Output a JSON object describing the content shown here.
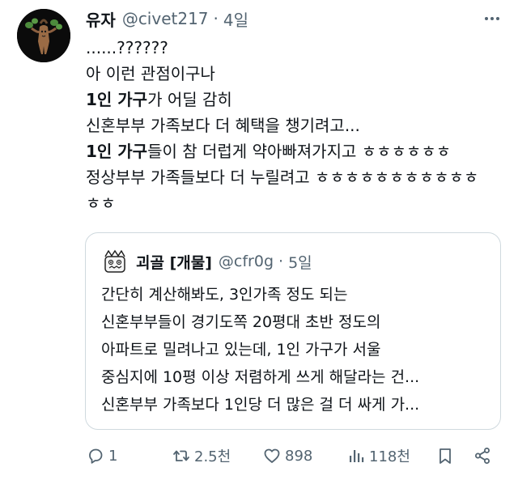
{
  "tweet": {
    "display_name": "유자",
    "handle": "@civet217",
    "separator": "·",
    "time": "4일",
    "avatar_icon": "mandrake-doll-avatar",
    "more_icon": "more-icon",
    "lines": [
      {
        "plain": "......??????"
      },
      {
        "plain": "아 이런 관점이구나"
      },
      {
        "bold": "1인 가구",
        "rest": "가 어딜 감히"
      },
      {
        "plain": "신혼부부 가족보다 더 혜택을 챙기려고..."
      },
      {
        "bold": "1인 가구",
        "rest": "들이 참 더럽게 약아빠져가지고 ㅎㅎㅎㅎㅎㅎ"
      },
      {
        "plain": "정상부부 가족들보다 더 누릴려고 ㅎㅎㅎㅎㅎㅎㅎㅎㅎㅎㅎ"
      },
      {
        "plain": "ㅎㅎ"
      }
    ]
  },
  "quote": {
    "display_name": "괴골 [개물]",
    "handle": "@cfr0g",
    "separator": "·",
    "time": "5일",
    "avatar_icon": "cartoon-face-avatar",
    "lines": [
      "간단히 계산해봐도, 3인가족 정도 되는",
      "신혼부부들이 경기도쪽 20평대 초반 정도의",
      "아파트로 밀려나고 있는데, 1인 가구가 서울",
      "중심지에 10평 이상 저렴하게 쓰게 해달라는 건...",
      "신혼부부 가족보다 1인당 더 많은 걸 더 싸게 가..."
    ]
  },
  "actions": {
    "reply": {
      "icon": "reply-icon",
      "count": "1"
    },
    "retweet": {
      "icon": "retweet-icon",
      "count": "2.5천"
    },
    "like": {
      "icon": "heart-icon",
      "count": "898"
    },
    "views": {
      "icon": "views-icon",
      "count": "118천"
    },
    "bookmark": {
      "icon": "bookmark-icon"
    },
    "share": {
      "icon": "share-icon"
    }
  },
  "colors": {
    "text": "#0f1419",
    "secondary": "#536471",
    "border": "#cfd9de",
    "background": "#ffffff"
  }
}
